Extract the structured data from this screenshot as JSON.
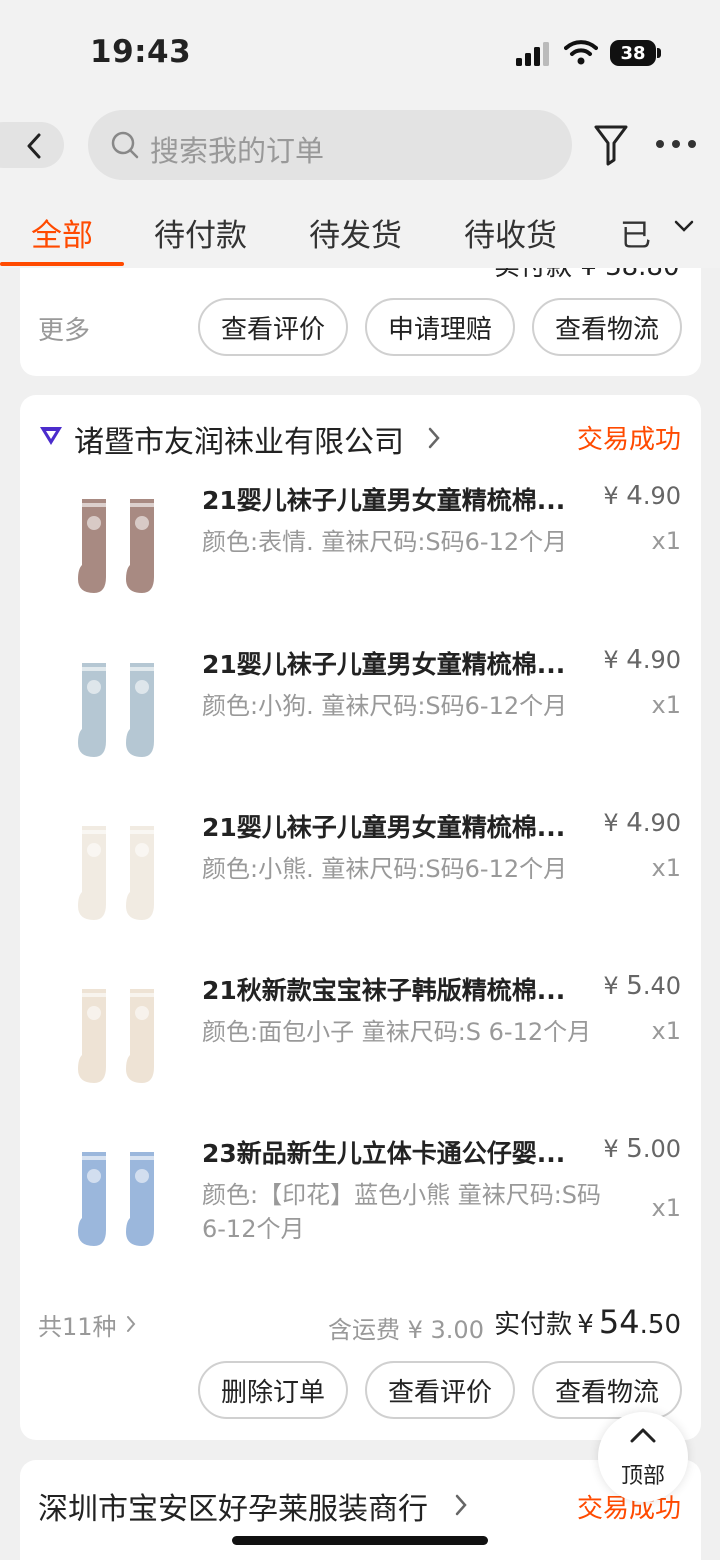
{
  "status_bar": {
    "time": "19:43",
    "battery": "38"
  },
  "search": {
    "placeholder": "搜索我的订单"
  },
  "tabs": [
    "全部",
    "待付款",
    "待发货",
    "待收货",
    "已"
  ],
  "prev_order": {
    "clipped_text": "实付款 ¥ 38.80",
    "more_label": "更多",
    "buttons": [
      "查看评价",
      "申请理赔",
      "查看物流"
    ]
  },
  "order": {
    "shop_name": "诸暨市友润袜业有限公司",
    "status": "交易成功",
    "items": [
      {
        "title": "21婴儿袜子儿童男女童精梳棉...",
        "spec": "颜色:表情. 童袜尺码:S码6-12个月",
        "price_symbol": "¥",
        "price_int": "4",
        "price_dec": ".90",
        "qty": "x1"
      },
      {
        "title": "21婴儿袜子儿童男女童精梳棉...",
        "spec": "颜色:小狗. 童袜尺码:S码6-12个月",
        "price_symbol": "¥",
        "price_int": "4",
        "price_dec": ".90",
        "qty": "x1"
      },
      {
        "title": "21婴儿袜子儿童男女童精梳棉...",
        "spec": "颜色:小熊. 童袜尺码:S码6-12个月",
        "price_symbol": "¥",
        "price_int": "4",
        "price_dec": ".90",
        "qty": "x1"
      },
      {
        "title": "21秋新款宝宝袜子韩版精梳棉...",
        "spec": "颜色:面包小子 童袜尺码:S 6-12个月",
        "price_symbol": "¥",
        "price_int": "5",
        "price_dec": ".40",
        "qty": "x1"
      },
      {
        "title": "23新品新生儿立体卡通公仔婴...",
        "spec": "颜色:【印花】蓝色小熊 童袜尺码:S码6-12个月",
        "price_symbol": "¥",
        "price_int": "5",
        "price_dec": ".00",
        "qty": "x1"
      }
    ],
    "total_kinds": "共11种",
    "shipping": "含运费 ¥ 3.00",
    "paid_label": "实付款",
    "paid_symbol": "¥",
    "paid_int": "54",
    "paid_dec": ".50",
    "buttons": [
      "删除订单",
      "查看评价",
      "查看物流"
    ]
  },
  "next_order": {
    "shop_name": "深圳市宝安区好孕莱服装商行",
    "status": "交易成功"
  },
  "scroll_top_label": "顶部",
  "sock_colors": [
    "#a88a82",
    "#b5c7d3",
    "#f1ebe2",
    "#eee3d5",
    "#9bb7dc"
  ]
}
